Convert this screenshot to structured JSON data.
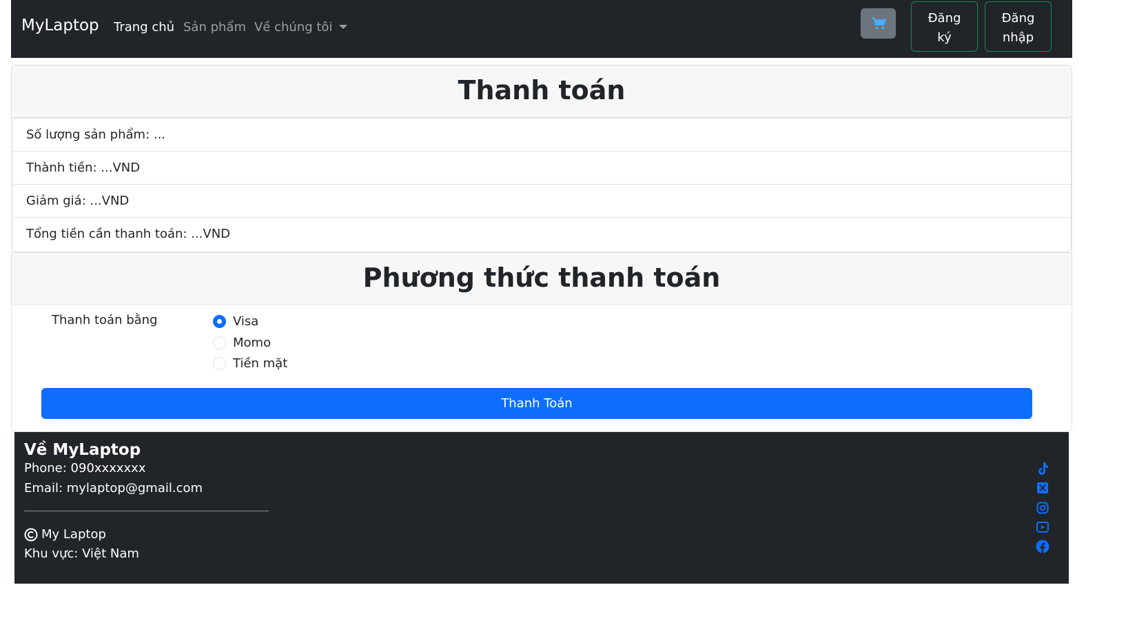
{
  "navbar": {
    "brand": "MyLaptop",
    "links": [
      {
        "label": "Trang chủ",
        "active": true
      },
      {
        "label": "Sản phẩm",
        "active": false
      },
      {
        "label": "Về chúng tôi",
        "active": false
      }
    ],
    "cart_icon": "cart-icon",
    "register_label": "Đăng ký",
    "login_label": "Đăng nhập"
  },
  "payment": {
    "title": "Thanh toán",
    "summary": [
      "Số lượng sản phẩm: ...",
      "Thành tiền: ...VND",
      "Giảm giá: ...VND",
      "Tổng tiền cần thanh toán: ...VND"
    ],
    "method_title": "Phương thức thanh toán",
    "pay_with_label": "Thanh toán bằng",
    "methods": [
      {
        "label": "Visa",
        "checked": true
      },
      {
        "label": "Momo",
        "checked": false
      },
      {
        "label": "Tiền mặt",
        "checked": false
      }
    ],
    "submit_label": "Thanh Toán"
  },
  "footer": {
    "title": "Về MyLaptop",
    "phone": "Phone: 090xxxxxxx",
    "email": "Email: mylaptop@gmail.com",
    "copyright": "My Laptop",
    "region": "Khu vực: Việt Nam",
    "social_icons": [
      "tiktok-icon",
      "x-twitter-icon",
      "instagram-icon",
      "youtube-icon",
      "facebook-icon"
    ]
  },
  "colors": {
    "navbar_bg": "#212529",
    "primary": "#0d6efd",
    "success_border": "#198754",
    "secondary": "#6c757d"
  }
}
